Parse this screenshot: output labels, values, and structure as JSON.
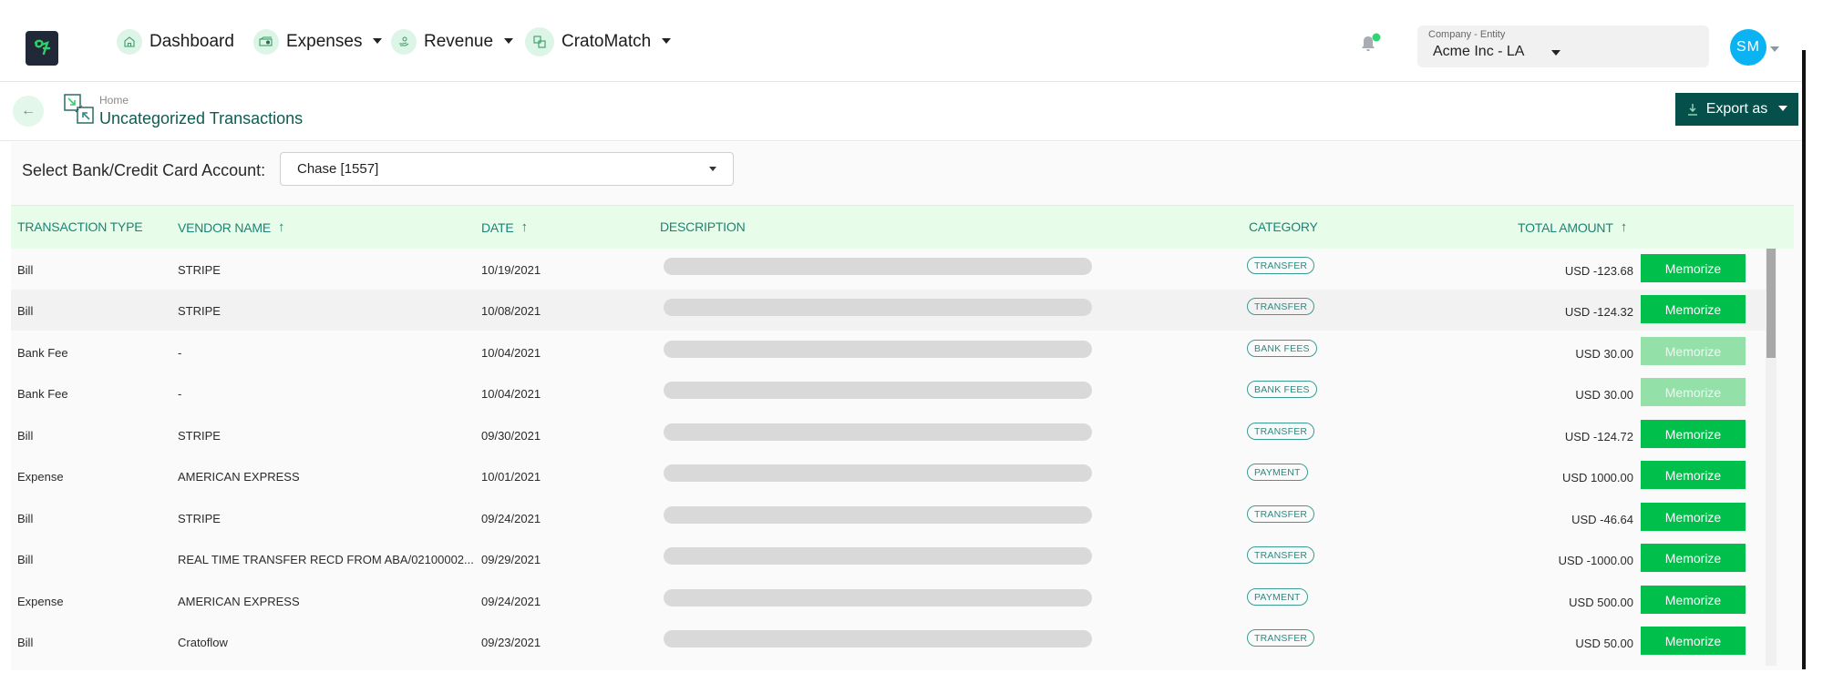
{
  "nav": {
    "items": [
      {
        "label": "Dashboard",
        "icon": "home-icon",
        "has_dropdown": false
      },
      {
        "label": "Expenses",
        "icon": "money-icon",
        "has_dropdown": true
      },
      {
        "label": "Revenue",
        "icon": "hand-coin-icon",
        "has_dropdown": true
      },
      {
        "label": "CratoMatch",
        "icon": "match-icon",
        "has_dropdown": true
      }
    ],
    "notification_dot_color": "#2ed573",
    "company": {
      "label": "Company - Entity",
      "value": "Acme Inc -  LA"
    },
    "avatar_initials": "SM",
    "avatar_color": "#0bb3f2"
  },
  "page": {
    "breadcrumb": "Home",
    "title": "Uncategorized Transactions",
    "export_label": "Export as"
  },
  "filter": {
    "label": "Select Bank/Credit Card Account:",
    "selected": "Chase [1557]"
  },
  "table": {
    "columns": [
      {
        "label": "TRANSACTION TYPE",
        "sortable": false
      },
      {
        "label": "VENDOR NAME",
        "sortable": true
      },
      {
        "label": "DATE",
        "sortable": true
      },
      {
        "label": "DESCRIPTION",
        "sortable": false
      },
      {
        "label": "CATEGORY",
        "sortable": false
      },
      {
        "label": "TOTAL AMOUNT",
        "sortable": true
      }
    ],
    "action_label": "Memorize",
    "rows": [
      {
        "type": "Bill",
        "vendor": "STRIPE",
        "date": "10/19/2021",
        "category": "TRANSFER",
        "amount": "USD -123.68",
        "action_enabled": true
      },
      {
        "type": "Bill",
        "vendor": "STRIPE",
        "date": "10/08/2021",
        "category": "TRANSFER",
        "amount": "USD -124.32",
        "action_enabled": true
      },
      {
        "type": "Bank Fee",
        "vendor": "-",
        "date": "10/04/2021",
        "category": "BANK FEES",
        "amount": "USD 30.00",
        "action_enabled": false
      },
      {
        "type": "Bank Fee",
        "vendor": "-",
        "date": "10/04/2021",
        "category": "BANK FEES",
        "amount": "USD 30.00",
        "action_enabled": false
      },
      {
        "type": "Bill",
        "vendor": "STRIPE",
        "date": "09/30/2021",
        "category": "TRANSFER",
        "amount": "USD -124.72",
        "action_enabled": true
      },
      {
        "type": "Expense",
        "vendor": "AMERICAN EXPRESS",
        "date": "10/01/2021",
        "category": "PAYMENT",
        "amount": "USD 1000.00",
        "action_enabled": true
      },
      {
        "type": "Bill",
        "vendor": "STRIPE",
        "date": "09/24/2021",
        "category": "TRANSFER",
        "amount": "USD -46.64",
        "action_enabled": true
      },
      {
        "type": "Bill",
        "vendor": "REAL TIME TRANSFER RECD FROM ABA/02100002...",
        "date": "09/29/2021",
        "category": "TRANSFER",
        "amount": "USD -1000.00",
        "action_enabled": true
      },
      {
        "type": "Expense",
        "vendor": "AMERICAN EXPRESS",
        "date": "09/24/2021",
        "category": "PAYMENT",
        "amount": "USD 500.00",
        "action_enabled": true
      },
      {
        "type": "Bill",
        "vendor": "Cratoflow",
        "date": "09/23/2021",
        "category": "TRANSFER",
        "amount": "USD 50.00",
        "action_enabled": true
      }
    ]
  },
  "colors": {
    "brand_dark": "#06504c",
    "accent_green": "#00c04b",
    "accent_green_disabled": "#93e1a9",
    "header_row_bg": "#e8fde9",
    "header_text": "#1c8377"
  }
}
